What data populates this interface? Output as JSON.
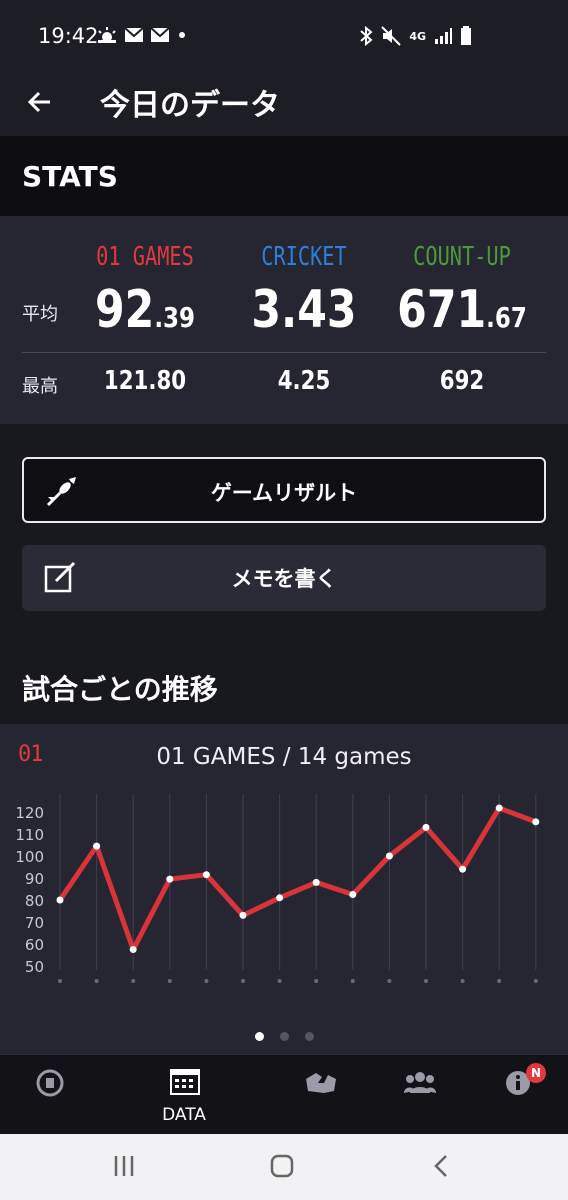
{
  "status_bar": {
    "time": "19:42",
    "network": "4G"
  },
  "app_bar": {
    "title": "今日のデータ"
  },
  "stats": {
    "heading": "STATS",
    "columns": [
      {
        "label": "01 GAMES",
        "color": "#e03a3e",
        "avg_int": "92",
        "avg_dec": ".39",
        "max": "121.80"
      },
      {
        "label": "CRICKET",
        "color": "#2f7ed8",
        "avg_int": "3.43",
        "avg_dec": "",
        "max": "4.25"
      },
      {
        "label": "COUNT-UP",
        "color": "#4c9a3a",
        "avg_int": "671",
        "avg_dec": ".67",
        "max": "692"
      }
    ],
    "avg_label": "平均",
    "max_label": "最高"
  },
  "buttons": {
    "game_result": "ゲームリザルト",
    "write_memo": "メモを書く"
  },
  "trend": {
    "heading": "試合ごとの推移",
    "chart_logo": "01",
    "caption": "01 GAMES / 14 games"
  },
  "chart_data": {
    "type": "line",
    "title": "01 GAMES / 14 games",
    "x": [
      1,
      2,
      3,
      4,
      5,
      6,
      7,
      8,
      9,
      10,
      11,
      12,
      13,
      14
    ],
    "series": [
      {
        "values": [
          80,
          104.5,
          57.5,
          89.5,
          91.5,
          73,
          81,
          88,
          82.5,
          100,
          113,
          94,
          121.8,
          115.5
        ],
        "color": "#d8343a"
      }
    ],
    "yticks": [
      50,
      60,
      70,
      80,
      90,
      100,
      110,
      120
    ],
    "ylim": [
      50,
      125
    ],
    "grid": "vertical"
  },
  "pager": {
    "count": 3,
    "active": 0
  },
  "bottom_nav": {
    "items": [
      {
        "name": "home",
        "label": ""
      },
      {
        "name": "data",
        "label": "DATA"
      },
      {
        "name": "shop",
        "label": ""
      },
      {
        "name": "friends",
        "label": ""
      },
      {
        "name": "info",
        "label": "",
        "badge": "N"
      }
    ]
  }
}
